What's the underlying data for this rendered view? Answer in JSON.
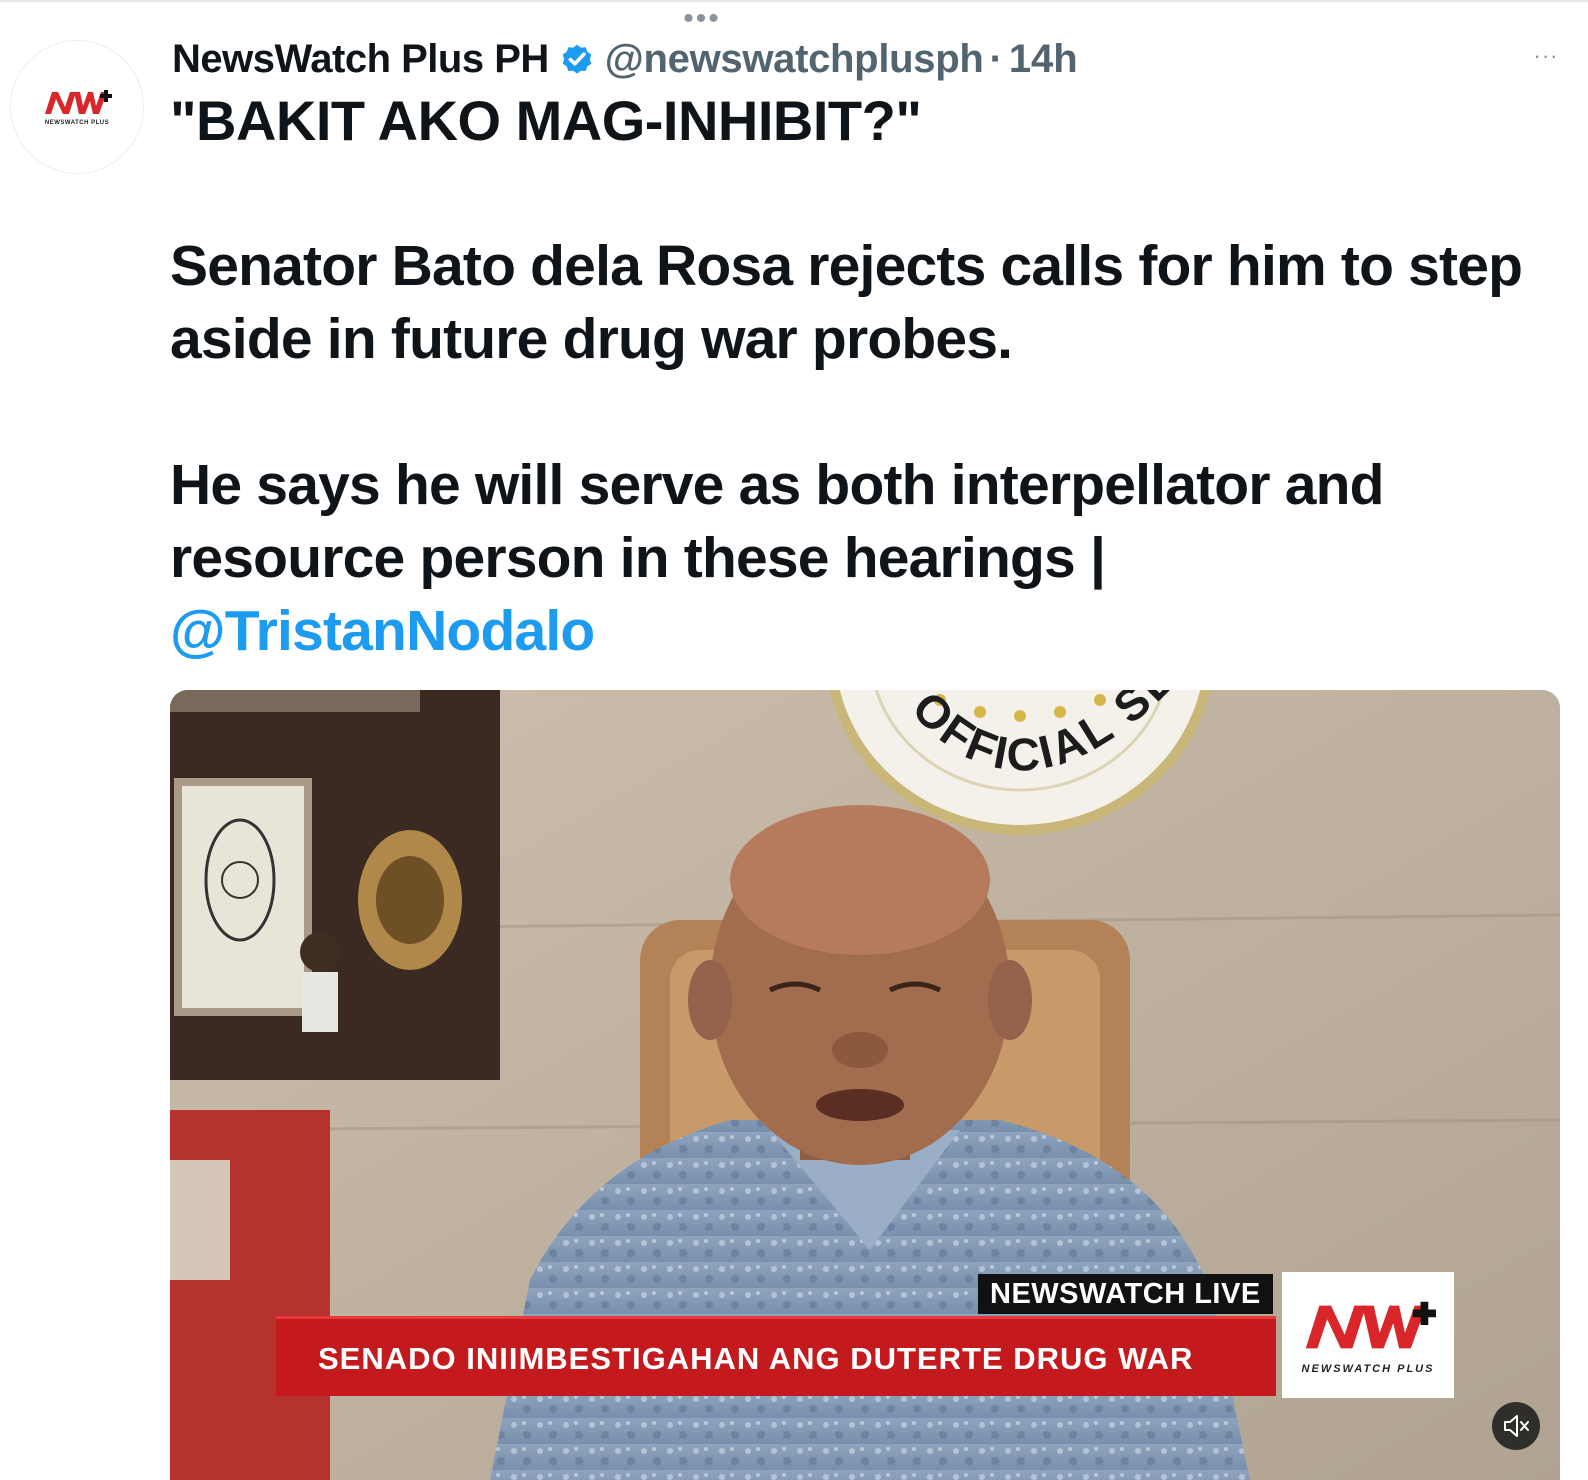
{
  "topbar": {
    "overflow_dots": "•••"
  },
  "author": {
    "display_name": "NewsWatch Plus PH",
    "handle": "@newswatchplusph",
    "separator": "·",
    "time": "14h",
    "avatar_logo": "NW+",
    "avatar_sub": "NEWSWATCH PLUS"
  },
  "more_menu": "···",
  "tweet": {
    "headline": "\"BAKIT AKO MAG-INHIBIT?\"",
    "paragraph_1": "Senator Bato dela Rosa rejects calls for him to step aside in future drug war probes.",
    "paragraph_2": "He says he will serve as both interpellator and resource person in these hearings |",
    "mention": "@TristanNodalo"
  },
  "media": {
    "seal_text": "OFFICIAL SEAL",
    "live_tag": "NEWSWATCH LIVE",
    "ticker": "SENADO INIIMBESTIGAHAN ANG DUTERTE DRUG WAR",
    "logo": "NW+",
    "logo_sub": "NEWSWATCH PLUS"
  },
  "colors": {
    "accent": "#1d9bf0",
    "ticker_red": "#c4191d",
    "logo_red": "#d8262b",
    "secondary_text": "#536471"
  },
  "icons": [
    "verified-badge-icon",
    "mute-icon",
    "more-icon"
  ]
}
